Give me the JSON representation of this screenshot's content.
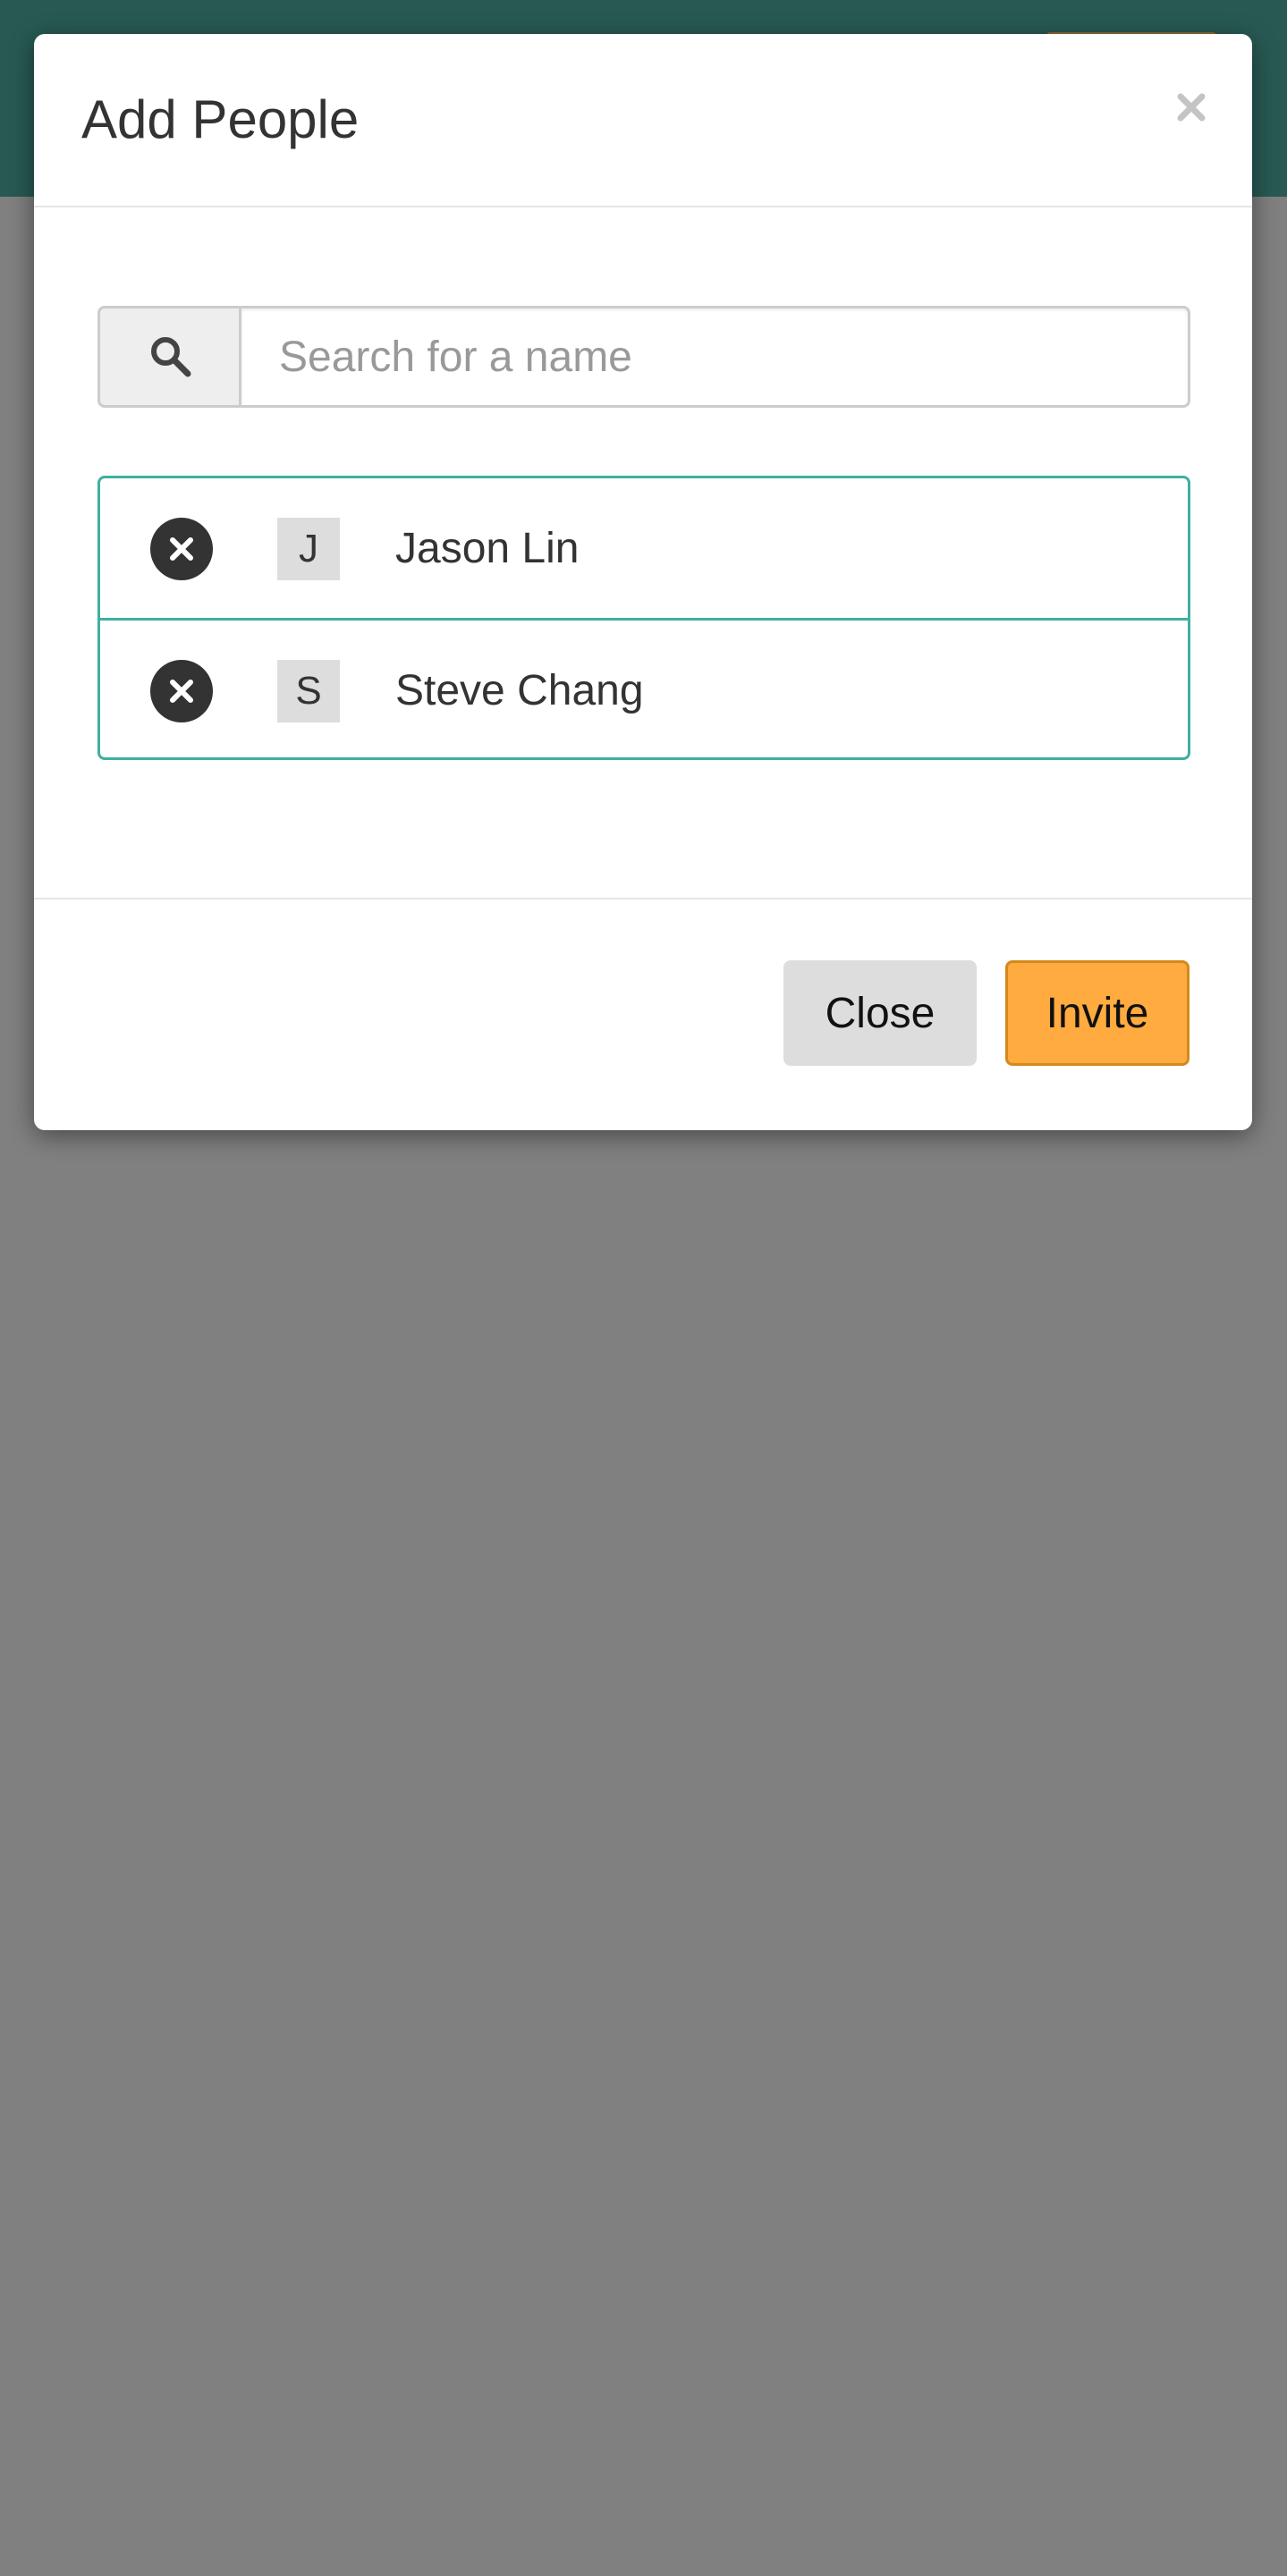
{
  "modal": {
    "title": "Add People",
    "close_icon": "close-icon"
  },
  "search": {
    "icon": "search-icon",
    "placeholder": "Search for a name",
    "value": ""
  },
  "people": [
    {
      "initial": "J",
      "name": "Jason Lin",
      "remove_icon": "remove-circle-icon"
    },
    {
      "initial": "S",
      "name": "Steve Chang",
      "remove_icon": "remove-circle-icon"
    }
  ],
  "footer": {
    "close_label": "Close",
    "invite_label": "Invite"
  },
  "colors": {
    "header_bg": "#285a53",
    "backdrop": "#808080",
    "list_border": "#3fb0a0",
    "invite_bg": "#ffab40",
    "close_bg": "#dddddd"
  }
}
